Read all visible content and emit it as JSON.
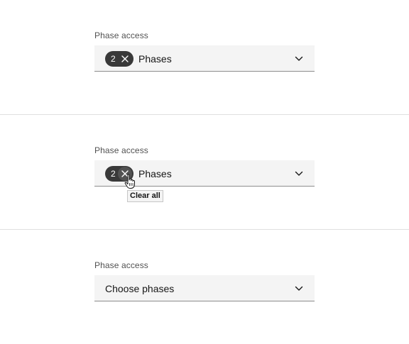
{
  "states": [
    {
      "label": "Phase access",
      "tag_count": "2",
      "value_text": "Phases",
      "tag_icon": "close-icon",
      "chevron_icon": "chevron-down-icon"
    },
    {
      "label": "Phase access",
      "tag_count": "2",
      "value_text": "Phases",
      "tag_icon": "close-icon",
      "chevron_icon": "chevron-down-icon",
      "tooltip": "Clear all",
      "cursor_icon": "pointer-hand-icon"
    },
    {
      "label": "Phase access",
      "value_text": "Choose phases",
      "chevron_icon": "chevron-down-icon"
    }
  ],
  "colors": {
    "tag_bg": "#393939",
    "field_bg": "#f4f4f4",
    "field_border": "#8d8d8d",
    "divider": "#e0e0e0"
  }
}
